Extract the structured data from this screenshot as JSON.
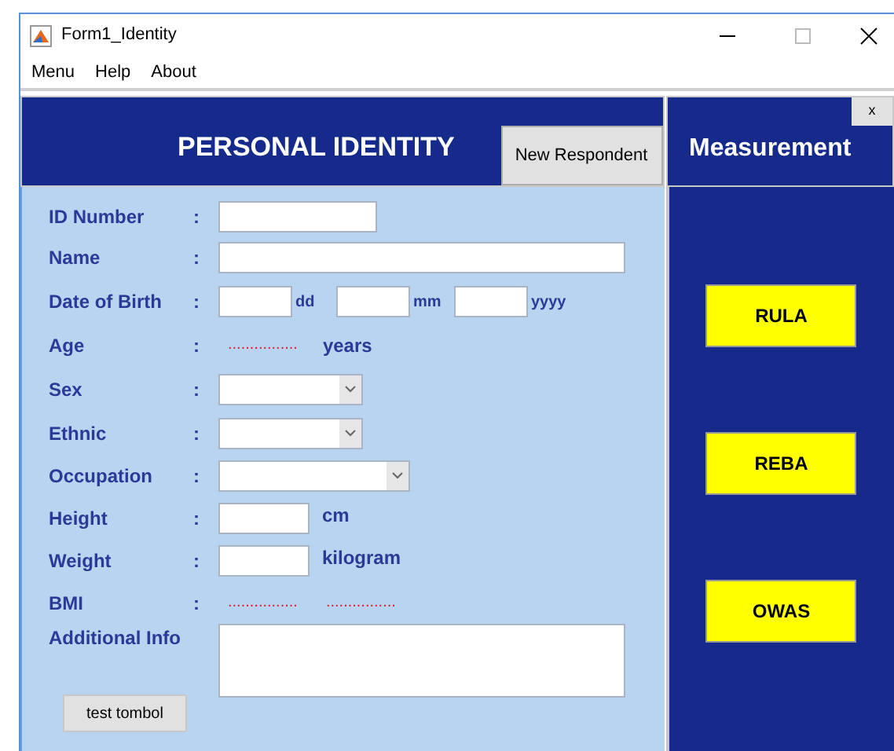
{
  "window": {
    "title": "Form1_Identity"
  },
  "menu": [
    "Menu",
    "Help",
    "About"
  ],
  "identity": {
    "title": "PERSONAL IDENTITY",
    "new_button": "New Respondent",
    "rows": [
      {
        "label": "ID Number",
        "colon": ":",
        "kind": "short_text"
      },
      {
        "label": "Name",
        "colon": ":",
        "kind": "long_text"
      },
      {
        "label": "Date of Birth",
        "colon": ":",
        "kind": "date",
        "units": [
          "dd",
          "mm",
          "yyyy"
        ]
      },
      {
        "label": "Age",
        "colon": ":",
        "kind": "readout",
        "readouts": [
          "................"
        ],
        "unit": "years"
      },
      {
        "label": "Sex",
        "colon": ":",
        "kind": "select"
      },
      {
        "label": "Ethnic",
        "colon": ":",
        "kind": "select"
      },
      {
        "label": "Occupation",
        "colon": ":",
        "kind": "wide_select"
      },
      {
        "label": "Height",
        "colon": ":",
        "kind": "unit",
        "unit": "cm"
      },
      {
        "label": "Weight",
        "colon": ":",
        "kind": "unit",
        "unit": "kilogram"
      },
      {
        "label": "BMI",
        "colon": ":",
        "kind": "readout",
        "readouts": [
          "................",
          "................"
        ]
      },
      {
        "label": "Additional Info",
        "kind": "textarea"
      }
    ],
    "test_button": "test tombol"
  },
  "measurement": {
    "title": "Measurement",
    "close": "x",
    "buttons": [
      "RULA",
      "REBA",
      "OWAS"
    ]
  }
}
